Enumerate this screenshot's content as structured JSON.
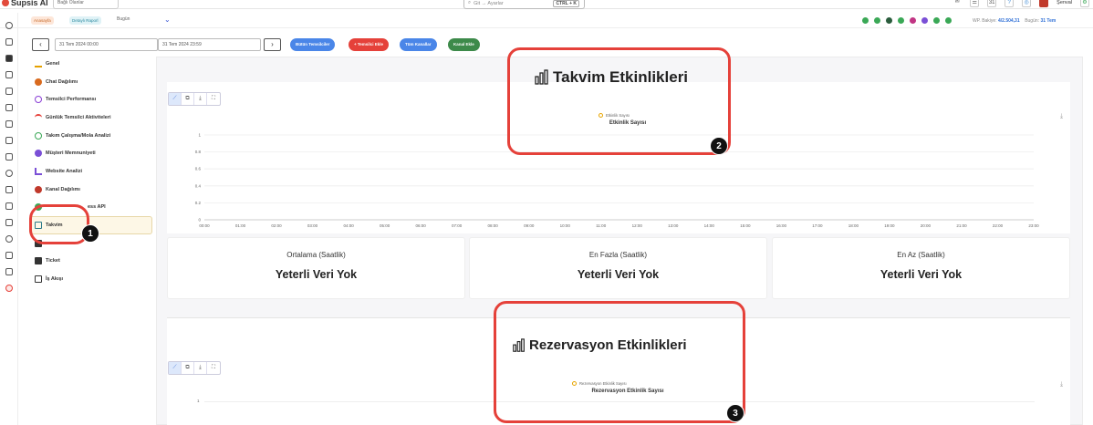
{
  "app": {
    "name": "Supsis AI"
  },
  "topbar": {
    "store_placeholder": "Bağlı Olanlar",
    "search_placeholder": "Git → Ayarlar",
    "search_shortcut": "CTRL + K",
    "calendar_day": "31",
    "user_name": "Şenval"
  },
  "filters": {
    "pill_a": "Anasayfa",
    "pill_b": "Detaylı Raporl",
    "period": "Bugün",
    "balance_label": "WP. Bakiye:",
    "balance_value": "4/2.504,31",
    "today_label": "Bugün:",
    "today_value": "31 Tem"
  },
  "date_range": {
    "start": "31 Tem 2024 00:00",
    "end": "31 Tem 2024 23:59",
    "buttons": [
      "Bütün Temsilciler",
      "+ Temsilci Ekle",
      "Tüm Kanallar",
      "Kanal Ekle"
    ]
  },
  "menu": {
    "items": [
      {
        "label": "Genel"
      },
      {
        "label": "Chat Dağılımı"
      },
      {
        "label": "Temsilci Performansı"
      },
      {
        "label": "Günlük Temsilci Aktiviteleri"
      },
      {
        "label": "Takım Çalışma/Mola Analizi"
      },
      {
        "label": "Müşteri Memnuniyeti"
      },
      {
        "label": "Website Analizi"
      },
      {
        "label": "Kanal Dağılımı"
      },
      {
        "label": "ess API"
      },
      {
        "label": "Takvim"
      },
      {
        "label": ""
      },
      {
        "label": "Ticket"
      },
      {
        "label": "İş Akışı"
      }
    ]
  },
  "chart1": {
    "title": "Takvim Etkinlikleri",
    "legend": "Etkinlik Sayısı",
    "series_title": "Etkinlik Sayısı"
  },
  "chart2": {
    "title": "Rezervasyon Etkinlikleri",
    "legend": "Rezervasyon Etkinlik Sayısı",
    "series_title": "Rezervasyon Etkinlik Sayısı",
    "first_tick": "1"
  },
  "stats": [
    {
      "label": "Ortalama (Saatlik)",
      "value": "Yeterli Veri Yok"
    },
    {
      "label": "En Fazla (Saatlik)",
      "value": "Yeterli Veri Yok"
    },
    {
      "label": "En Az (Saatlik)",
      "value": "Yeterli Veri Yok"
    }
  ],
  "badges": [
    "1",
    "2",
    "3"
  ],
  "chart_data": {
    "type": "line",
    "title": "Takvim Etkinlikleri",
    "series": [
      {
        "name": "Etkinlik Sayısı",
        "values": []
      }
    ],
    "x": [
      "00:00",
      "01:00",
      "02:00",
      "03:00",
      "04:00",
      "05:00",
      "06:00",
      "07:00",
      "08:00",
      "09:00",
      "10:00",
      "11:00",
      "12:00",
      "13:00",
      "14:00",
      "15:00",
      "16:00",
      "17:00",
      "18:00",
      "19:00",
      "20:00",
      "21:00",
      "22:00",
      "23:00"
    ],
    "yticks": [
      "0",
      "0.2",
      "0.4",
      "0.6",
      "0.8",
      "1"
    ],
    "ylim": [
      0,
      1
    ]
  }
}
